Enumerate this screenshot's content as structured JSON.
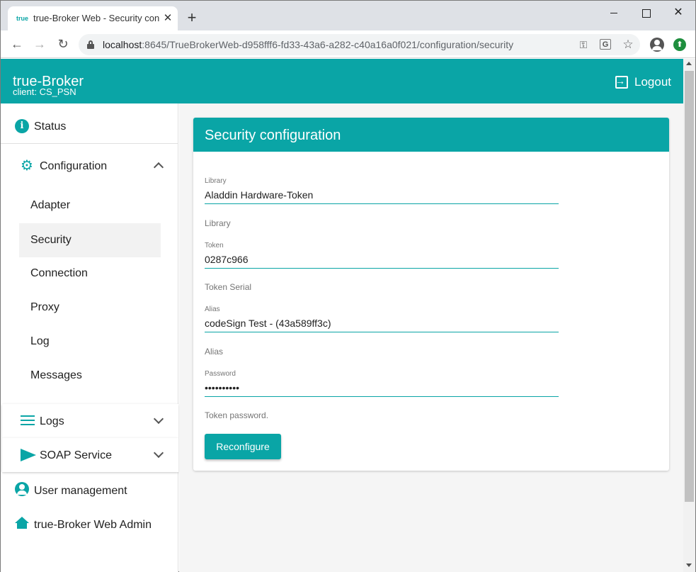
{
  "browser": {
    "tab_title": "true-Broker Web - Security configuration",
    "tab_favicon": "true",
    "url_host": "localhost",
    "url_rest": ":8645/TrueBrokerWeb-d958fff6-fd33-43a6-a282-c40a16a0f021/configuration/security",
    "icons": [
      "lock-icon",
      "key-icon",
      "translate-icon",
      "star-icon",
      "profile-icon",
      "extension-icon"
    ]
  },
  "header": {
    "title": "true-Broker",
    "client": "client: CS_PSN",
    "logout_label": "Logout"
  },
  "sidebar": {
    "status": "Status",
    "configuration": "Configuration",
    "config_items": [
      "Adapter",
      "Security",
      "Connection",
      "Proxy",
      "Log",
      "Messages"
    ],
    "active_item": "Security",
    "logs": "Logs",
    "soap": "SOAP Service",
    "user_management": "User management",
    "web_admin": "true-Broker Web Admin"
  },
  "card": {
    "title": "Security configuration",
    "fields": [
      {
        "label": "Library",
        "value": "Aladdin Hardware-Token",
        "hint": "Library"
      },
      {
        "label": "Token",
        "value": "0287c966",
        "hint": "Token Serial"
      },
      {
        "label": "Alias",
        "value": "codeSign Test - (43a589ff3c)",
        "hint": "Alias"
      },
      {
        "label": "Password",
        "value": "••••••••••",
        "hint": "Token password."
      }
    ],
    "button_label": "Reconfigure"
  },
  "colors": {
    "accent": "#0aa5a6",
    "active_bg": "#f2f2f2"
  }
}
